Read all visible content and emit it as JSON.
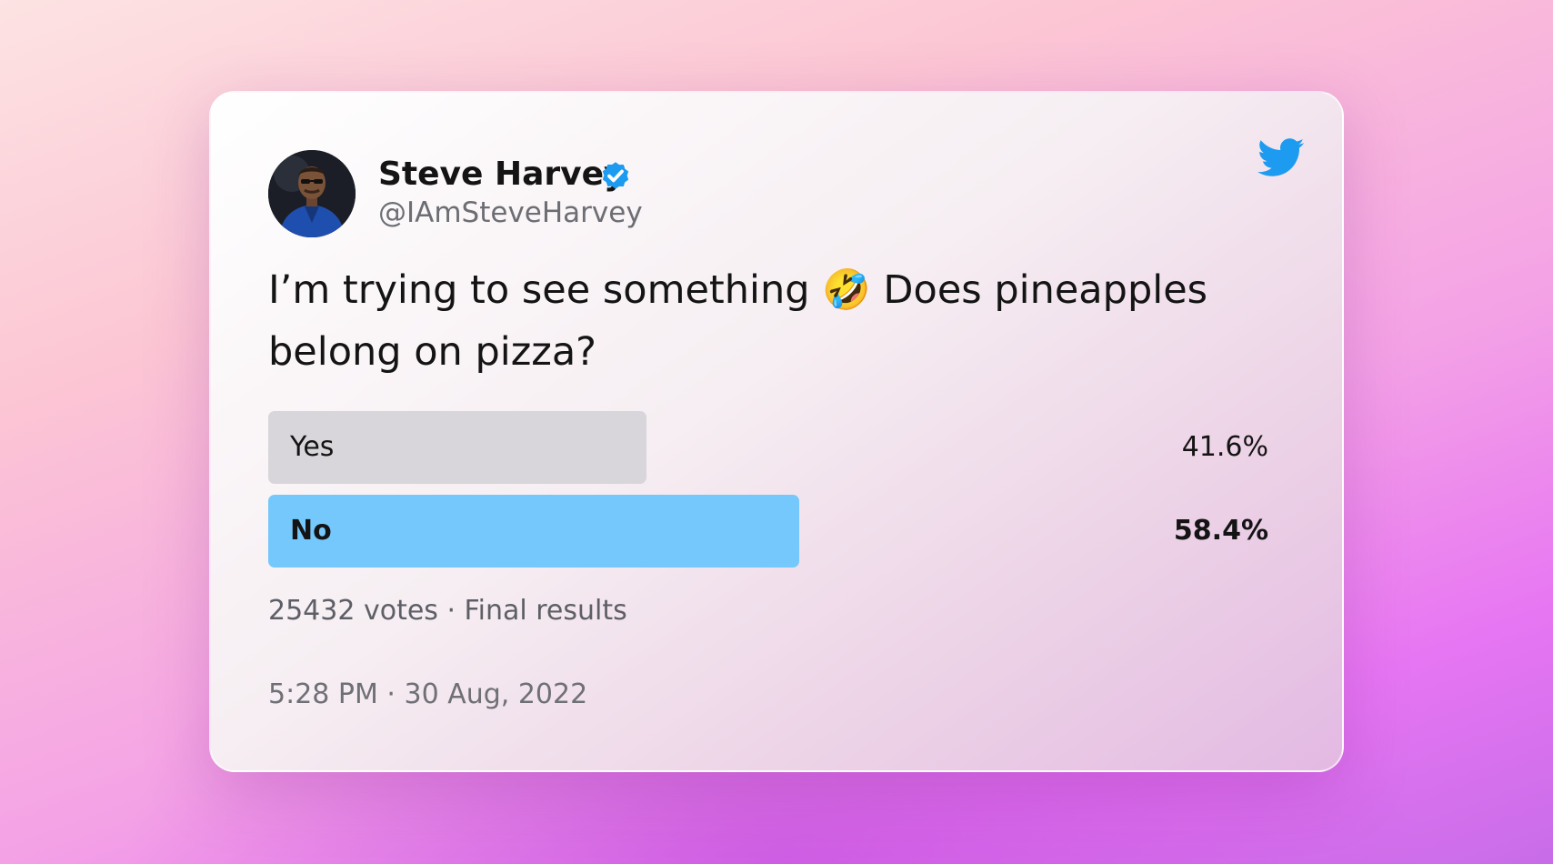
{
  "tweet": {
    "author": {
      "name": "Steve Harvey",
      "handle": "@IAmSteveHarvey",
      "verified": true
    },
    "text": "I’m trying to see something 🤣 Does pineapples belong on pizza?",
    "poll": {
      "options": [
        {
          "label": "Yes",
          "percent_text": "41.6%",
          "share": 0.416,
          "winner": false
        },
        {
          "label": "No",
          "percent_text": "58.4%",
          "share": 0.584,
          "winner": true
        }
      ],
      "summary": "25432 votes · Final results"
    },
    "timestamp": "5:28 PM · 30 Aug, 2022"
  },
  "icons": {
    "brand": "twitter-bird-icon",
    "badge": "verified-check-icon"
  },
  "colors": {
    "twitter_blue": "#1d9bf0",
    "winner_bar": "#75c8fb",
    "loser_bar": "#d8d6da"
  }
}
